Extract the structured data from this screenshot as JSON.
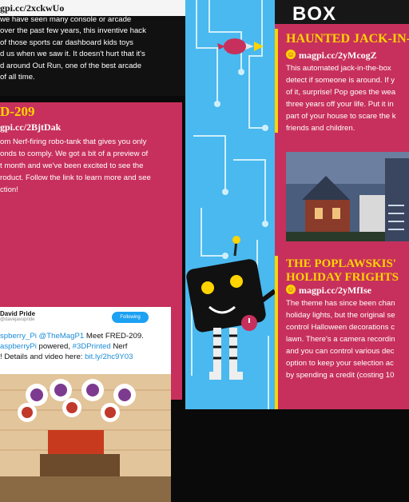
{
  "left_top": {
    "link": "gpi.cc/2xckwUo",
    "lines": [
      "we have seen many console or arcade",
      "over the past few years, this inventive hack",
      "of those sports car dashboard kids toys",
      "d us when we saw it. It doesn't hurt that it's",
      "d around Out Run, one of the best arcade",
      "of all time."
    ]
  },
  "fred": {
    "title": "D-209",
    "link": "gpi.cc/2BjtDak",
    "lines": [
      "om Nerf-firing robo-tank that gives you only",
      "onds to comply. We got a bit of a preview of",
      "t month and we've been excited to see the",
      "roduct. Follow the link to learn more and see",
      "ction!"
    ]
  },
  "tweet": {
    "name": "David Pride",
    "handle": "@davejavupride",
    "follow": "Following",
    "line1_a": "spberry_Pi @TheMagP1",
    "line1_b": " Meet FRED-209.",
    "line2_a": "aspberryPi",
    "line2_b": " powered, ",
    "line2_c": "#3DPrinted",
    "line2_d": " Nerf",
    "line3_a": "! Details and video here: ",
    "line3_b": "bit.ly/2hc9Y03"
  },
  "right_top": {
    "box": "BOX"
  },
  "haunted": {
    "title": "HAUNTED JACK-IN-T",
    "link": "magpi.cc/2yMcogZ",
    "lines": [
      "This automated jack-in-the-box",
      "detect if someone is around. If y",
      "of it, surprise! Pop goes the wea",
      "three years off your life. Put it in",
      "part of your house to scare the k",
      "friends and children."
    ]
  },
  "poplawskis": {
    "title_1": "THE POPLAWSKIS'",
    "title_2": "HOLIDAY FRIGHTS",
    "link": "magpi.cc/2yMfIse",
    "lines": [
      "The theme has since been chan",
      "holiday lights, but the original se",
      "control Halloween decorations c",
      "lawn. There's a camera recordin",
      "and you can control various dec",
      "option to keep your selection ac",
      "by spending a credit (costing 10"
    ]
  },
  "colors": {
    "card_pink": "#c7305c",
    "accent_yellow": "#ffd400",
    "strip_blue": "#49b9ef",
    "link_blue": "#1b8cd8"
  }
}
